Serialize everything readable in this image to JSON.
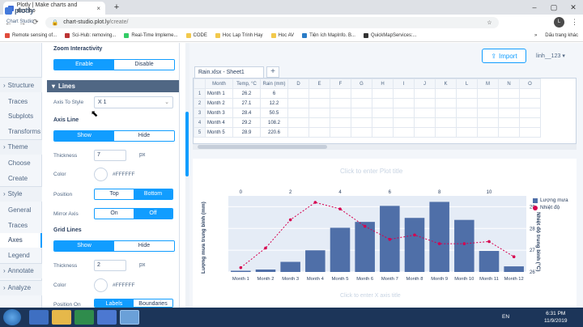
{
  "browser": {
    "tab_title": "Plotly | Make charts and dashbo",
    "url_domain": "chart-studio.plot.ly",
    "url_path": "/create/",
    "bookmarks": [
      "Remote sensing of...",
      "Sci-Hub: removing...",
      "Real-Time Impleme...",
      "CODE",
      "Hoc Lap Trinh Hay",
      "Hoc AV",
      "Tiện ích MapInfo. B...",
      "QuickMapServices:..."
    ],
    "bookmarks_overflow": "»",
    "other_bookmarks": "Dấu trang khác"
  },
  "app": {
    "logo": "plotly",
    "logo_sub": "Chart Studio",
    "nav": [
      {
        "type": "section",
        "label": "Structure"
      },
      {
        "type": "item",
        "label": "Traces"
      },
      {
        "type": "item",
        "label": "Subplots"
      },
      {
        "type": "item",
        "label": "Transforms"
      },
      {
        "type": "section",
        "label": "Theme"
      },
      {
        "type": "item",
        "label": "Choose"
      },
      {
        "type": "item",
        "label": "Create"
      },
      {
        "type": "section",
        "label": "Style"
      },
      {
        "type": "item",
        "label": "General"
      },
      {
        "type": "item",
        "label": "Traces"
      },
      {
        "type": "item",
        "label": "Axes",
        "active": true
      },
      {
        "type": "item",
        "label": "Legend"
      },
      {
        "type": "section",
        "label": "Annotate"
      },
      {
        "type": "section",
        "label": "Analyze"
      }
    ]
  },
  "panel": {
    "zoom_title": "Zoom Interactivity",
    "zoom_enable": "Enable",
    "zoom_disable": "Disable",
    "lines_header": "Lines",
    "axis_to_style_label": "Axis To Style",
    "axis_to_style_value": "X 1",
    "axis_line_title": "Axis Line",
    "show": "Show",
    "hide": "Hide",
    "thickness_label": "Thickness",
    "axis_thickness": "7",
    "unit_px": "px",
    "color_label": "Color",
    "axis_color": "#FFFFFF",
    "position_label": "Position",
    "pos_top": "Top",
    "pos_bottom": "Bottom",
    "mirror_label": "Mirror Axis",
    "on": "On",
    "off": "Off",
    "grid_title": "Grid Lines",
    "grid_thickness": "2",
    "grid_color": "#FFFFFF",
    "position_on_label": "Position On",
    "labels": "Labels",
    "boundaries": "Boundaries"
  },
  "workspace": {
    "import_label": "Import",
    "user": "linh__123",
    "sheet_tab": "Rain.xlsx - Sheet1",
    "sheet_add": "+",
    "columns": [
      "Month",
      "Temp, °C",
      "Rain (mm)",
      "D",
      "E",
      "F",
      "G",
      "H",
      "I",
      "J",
      "K",
      "L",
      "M",
      "N",
      "O"
    ],
    "rows": [
      [
        "1",
        "Month 1",
        "26.2",
        "6"
      ],
      [
        "2",
        "Month 2",
        "27.1",
        "12.2"
      ],
      [
        "3",
        "Month 3",
        "28.4",
        "50.5"
      ],
      [
        "4",
        "Month 4",
        "29.2",
        "108.2"
      ],
      [
        "5",
        "Month 5",
        "28.9",
        "220.6"
      ]
    ],
    "title_hint": "Click to enter Plot title",
    "xaxis_hint": "Click to enter X axis title"
  },
  "chart_data": {
    "type": "bar",
    "categories": [
      "Month 1",
      "Month 2",
      "Month 3",
      "Month 4",
      "Month 5",
      "Month 6",
      "Month 7",
      "Month 8",
      "Month 9",
      "Month 10",
      "Month 11",
      "Month 12"
    ],
    "series": [
      {
        "name": "Lượng mưa",
        "type": "bar",
        "color": "#4f6fa8",
        "values": [
          6,
          12.2,
          50.5,
          108.2,
          220.6,
          250,
          330,
          270,
          350,
          260,
          105,
          28
        ]
      },
      {
        "name": "Nhiệt độ",
        "type": "line",
        "color": "#d6004f",
        "values": [
          26.2,
          27.1,
          28.4,
          29.2,
          28.9,
          28.1,
          27.5,
          27.7,
          27.3,
          27.3,
          27.4,
          26.7
        ]
      }
    ],
    "ylabel": "Lượng mưa trung bình (mm)",
    "y2label": "Nhiệt độ trung bình (°C)",
    "ylim": [
      0,
      380
    ],
    "y2lim": [
      26,
      29.5
    ],
    "y2ticks": [
      26,
      27,
      28,
      29
    ],
    "top_ticks": [
      "0",
      "2",
      "4",
      "6",
      "8",
      "10"
    ],
    "legend": "top-right",
    "grid": true
  },
  "taskbar": {
    "lang": "EN",
    "time": "6:31 PM",
    "date": "11/9/2019"
  }
}
